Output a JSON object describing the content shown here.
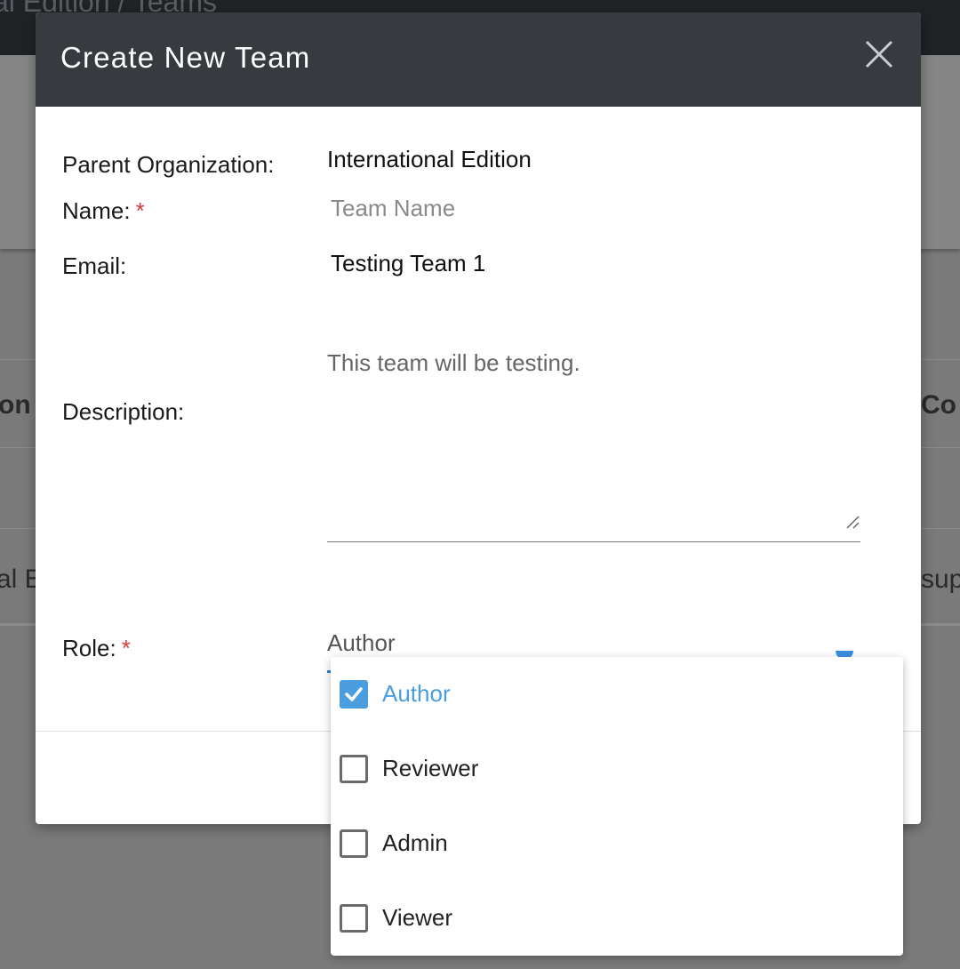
{
  "background": {
    "breadcrumb": "al Edition / Teams",
    "table_header_left": "on",
    "table_header_right": "Co",
    "table_row_left": "al E",
    "table_row_right": "sup"
  },
  "modal": {
    "title": "Create New Team",
    "fields": {
      "parent_org_label": "Parent Organization:",
      "parent_org_value": "International Edition",
      "name_label": "Name:",
      "name_required": "*",
      "name_placeholder": "Team Name",
      "email_label": "Email:",
      "email_value": "Testing Team 1",
      "description_label": "Description:",
      "description_value": "This team will be testing.",
      "role_label": "Role:",
      "role_required": "*",
      "role_value": "Author"
    }
  },
  "role_dropdown": {
    "options": [
      {
        "label": "Author",
        "checked": true
      },
      {
        "label": "Reviewer",
        "checked": false
      },
      {
        "label": "Admin",
        "checked": false
      },
      {
        "label": "Viewer",
        "checked": false
      }
    ]
  },
  "colors": {
    "header_bg": "#373b40",
    "accent": "#4a9ee0",
    "required": "#d93b3b"
  },
  "icons": {
    "close": "close-icon",
    "check": "check-icon",
    "caret": "chevron-down-icon"
  }
}
